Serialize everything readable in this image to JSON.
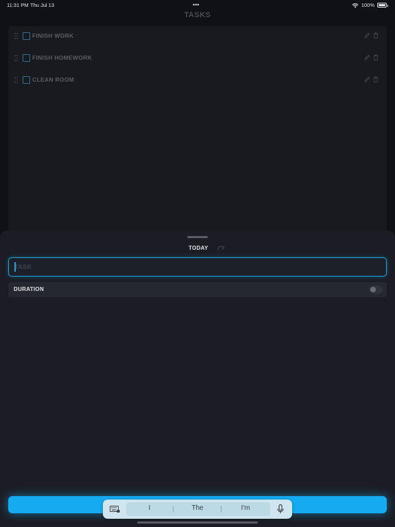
{
  "status_bar": {
    "time": "11:31 PM",
    "date": "Thu Jul 13",
    "multitask_dots": "•••",
    "battery": "100%",
    "icons": [
      "wifi-icon",
      "battery-icon"
    ]
  },
  "header": {
    "title": "TASKS"
  },
  "tasks": [
    {
      "label": "FINISH WORK",
      "checked": false
    },
    {
      "label": "FINISH HOMEWORK",
      "checked": false
    },
    {
      "label": "CLEAN ROOM",
      "checked": false
    }
  ],
  "sheet": {
    "tab_label": "TODAY",
    "task_input": {
      "value": "",
      "placeholder": "TASK"
    },
    "duration": {
      "label": "DURATION",
      "enabled": false
    }
  },
  "keyboard": {
    "suggestions": [
      "I",
      "The",
      "I'm"
    ]
  },
  "colors": {
    "accent": "#16aaf0",
    "background": "#101116",
    "sheet": "#1c1d24"
  }
}
